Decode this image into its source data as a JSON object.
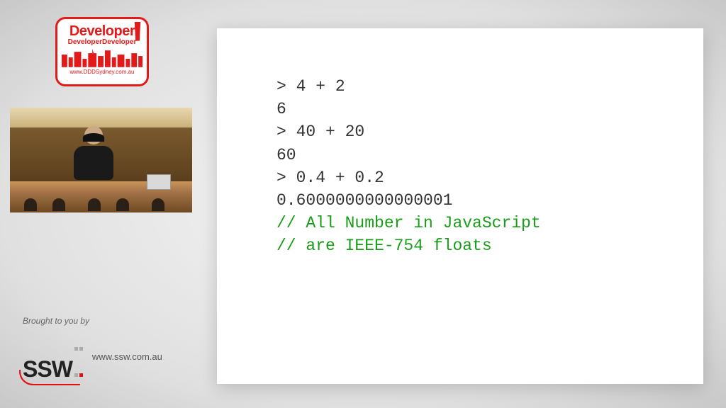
{
  "logo": {
    "main": "Developer",
    "sub": "DeveloperDeveloper",
    "url": "www.DDDSydney.com.au"
  },
  "sponsor": {
    "brought": "Brought to you by",
    "name": "SSW",
    "url": "www.ssw.com.au"
  },
  "slide": {
    "lines": [
      {
        "text": "> 4 + 2",
        "comment": false
      },
      {
        "text": "6",
        "comment": false
      },
      {
        "text": "> 40 + 20",
        "comment": false
      },
      {
        "text": "60",
        "comment": false
      },
      {
        "text": "> 0.4 + 0.2",
        "comment": false
      },
      {
        "text": "0.6000000000000001",
        "comment": false
      },
      {
        "text": "// All Number in JavaScript",
        "comment": true
      },
      {
        "text": "// are IEEE-754 floats",
        "comment": true
      }
    ]
  }
}
